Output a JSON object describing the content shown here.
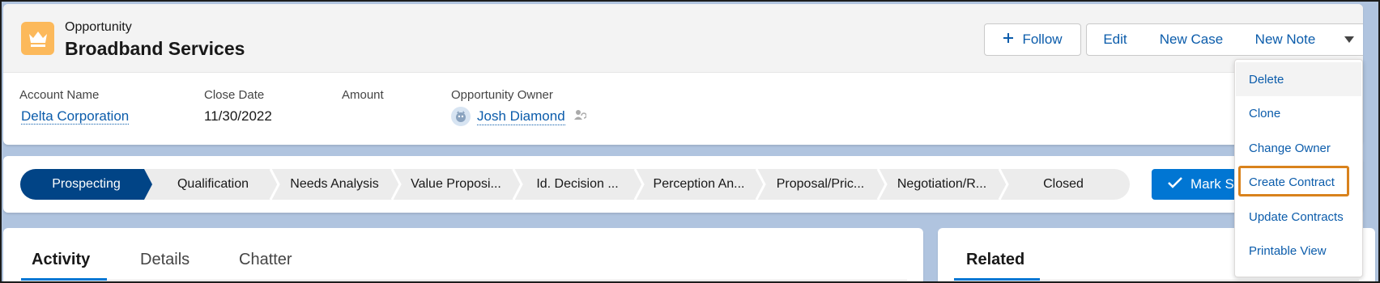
{
  "header": {
    "object_label": "Opportunity",
    "record_name": "Broadband Services",
    "record_icon": "crown-icon",
    "icon_color": "#fcb95b"
  },
  "actions": {
    "follow": "Follow",
    "edit": "Edit",
    "new_case": "New Case",
    "new_note": "New Note"
  },
  "fields": [
    {
      "label": "Account Name",
      "value": "Delta Corporation"
    },
    {
      "label": "Close Date",
      "value": "11/30/2022"
    },
    {
      "label": "Amount",
      "value": ""
    },
    {
      "label": "Opportunity Owner",
      "value": "Josh Diamond"
    }
  ],
  "path": {
    "stages": [
      "Prospecting",
      "Qualification",
      "Needs Analysis",
      "Value Proposi...",
      "Id. Decision ...",
      "Perception An...",
      "Proposal/Pric...",
      "Negotiation/R...",
      "Closed"
    ],
    "current_index": 0,
    "mark_button": "Mark S"
  },
  "tabs": {
    "main": [
      "Activity",
      "Details",
      "Chatter"
    ],
    "active": "Activity",
    "side": "Related"
  },
  "menu": {
    "items": [
      "Delete",
      "Clone",
      "Change Owner",
      "Create Contract",
      "Update Contracts",
      "Printable View"
    ],
    "hovered": "Delete",
    "highlighted": "Create Contract",
    "highlight_color": "#d9821c"
  },
  "colors": {
    "brand_blue": "#0176d3",
    "current_stage": "#014486",
    "link": "#0b5cab"
  }
}
